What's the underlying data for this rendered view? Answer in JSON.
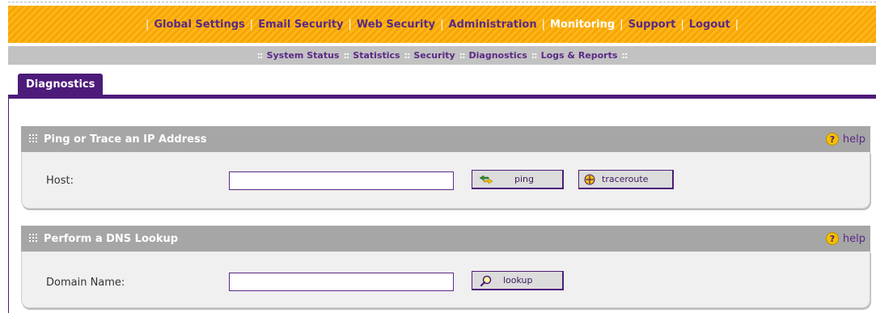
{
  "topnav": {
    "items": [
      {
        "label": "Global Settings",
        "active": false
      },
      {
        "label": "Email Security",
        "active": false
      },
      {
        "label": "Web Security",
        "active": false
      },
      {
        "label": "Administration",
        "active": false
      },
      {
        "label": "Monitoring",
        "active": true
      },
      {
        "label": "Support",
        "active": false
      },
      {
        "label": "Logout",
        "active": false
      }
    ],
    "separator": "|"
  },
  "subnav": {
    "items": [
      "System Status",
      "Statistics",
      "Security",
      "Diagnostics",
      "Logs & Reports"
    ],
    "separator": "::"
  },
  "tab": {
    "label": "Diagnostics"
  },
  "ping_section": {
    "title": "Ping or Trace an IP Address",
    "help_label": "help",
    "host_label": "Host:",
    "host_value": "",
    "ping_button": "ping",
    "traceroute_button": "traceroute"
  },
  "dns_section": {
    "title": "Perform a DNS Lookup",
    "help_label": "help",
    "domain_label": "Domain Name:",
    "domain_value": "",
    "lookup_button": "lookup"
  },
  "colors": {
    "accent_purple": "#4d1b7a",
    "nav_orange": "#f7a600",
    "subnav_gray": "#c2c2c2",
    "section_gray": "#a6a6a6"
  },
  "icons": {
    "grip": "grip-icon",
    "help": "help-icon",
    "ping": "ping-arrows-icon",
    "traceroute": "crosshair-icon",
    "lookup": "magnifier-icon"
  }
}
